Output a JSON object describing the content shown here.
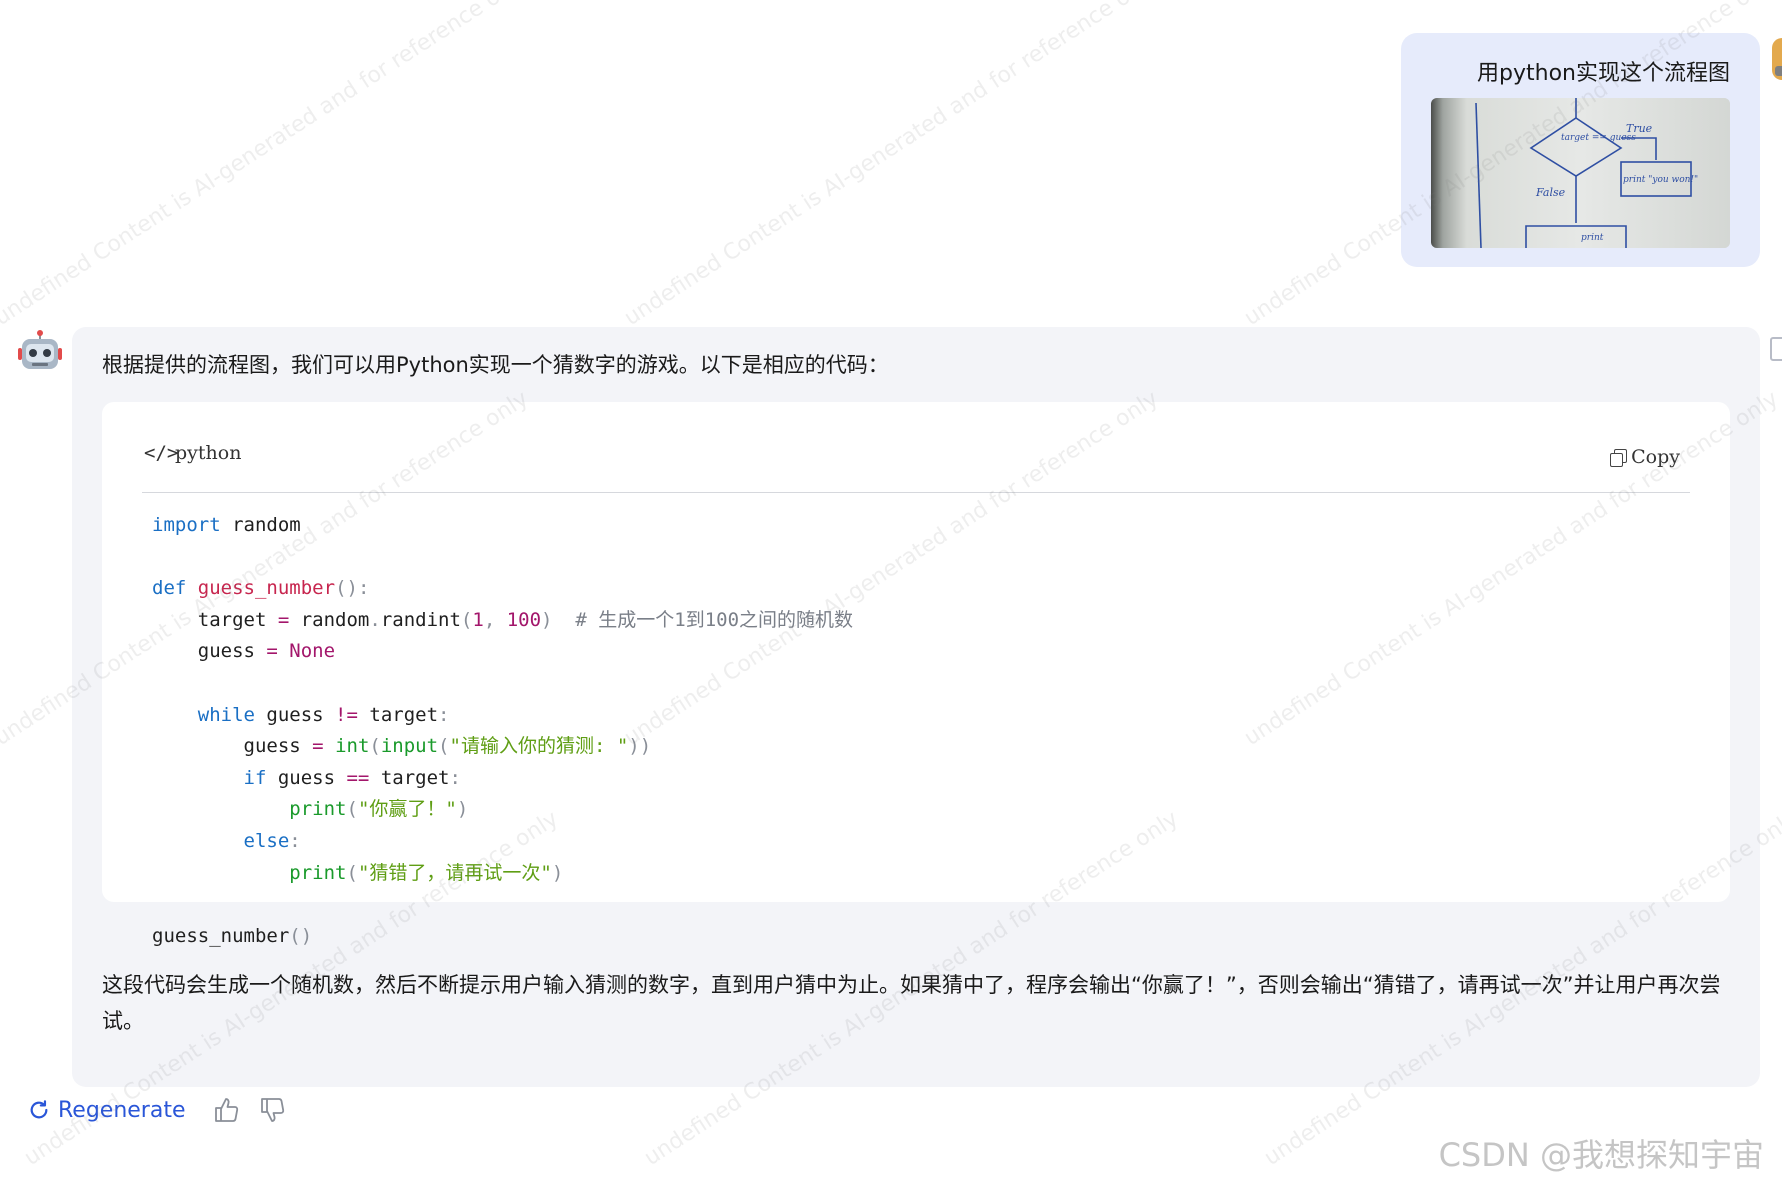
{
  "user": {
    "message": "用python实现这个流程图",
    "image_alt": "whiteboard flowchart photo",
    "image_texts": {
      "decision": "target == guess",
      "true_label": "True",
      "false_label": "False",
      "print_win": "print \"you won!\"",
      "print_bottom": "print"
    }
  },
  "assistant": {
    "intro": "根据提供的流程图，我们可以用Python实现一个猜数字的游戏。以下是相应的代码：",
    "code_block": {
      "language": "python",
      "copy_label": "Copy"
    },
    "outro": "这段代码会生成一个随机数，然后不断提示用户输入猜测的数字，直到用户猜中为止。如果猜中了，程序会输出“你赢了！”，否则会输出“猜错了，请再试一次”并让用户再次尝试。"
  },
  "actions": {
    "regenerate_label": "Regenerate"
  },
  "watermark": {
    "text": "undefined Content is AI-generated and for reference only"
  },
  "site_watermark": "CSDN @我想探知宇宙",
  "colors": {
    "accent": "#2a56d8",
    "user_bubble": "#e6ebfb",
    "answer_card": "#f3f4f8",
    "keyword": "#1a6fc4",
    "string": "#5f9e14",
    "number": "#a3166b",
    "comment": "#7a7f88"
  },
  "icons": [
    "robot-icon",
    "code-icon",
    "copy-icon",
    "regenerate-icon",
    "thumbs-up-icon",
    "thumbs-down-icon"
  ]
}
